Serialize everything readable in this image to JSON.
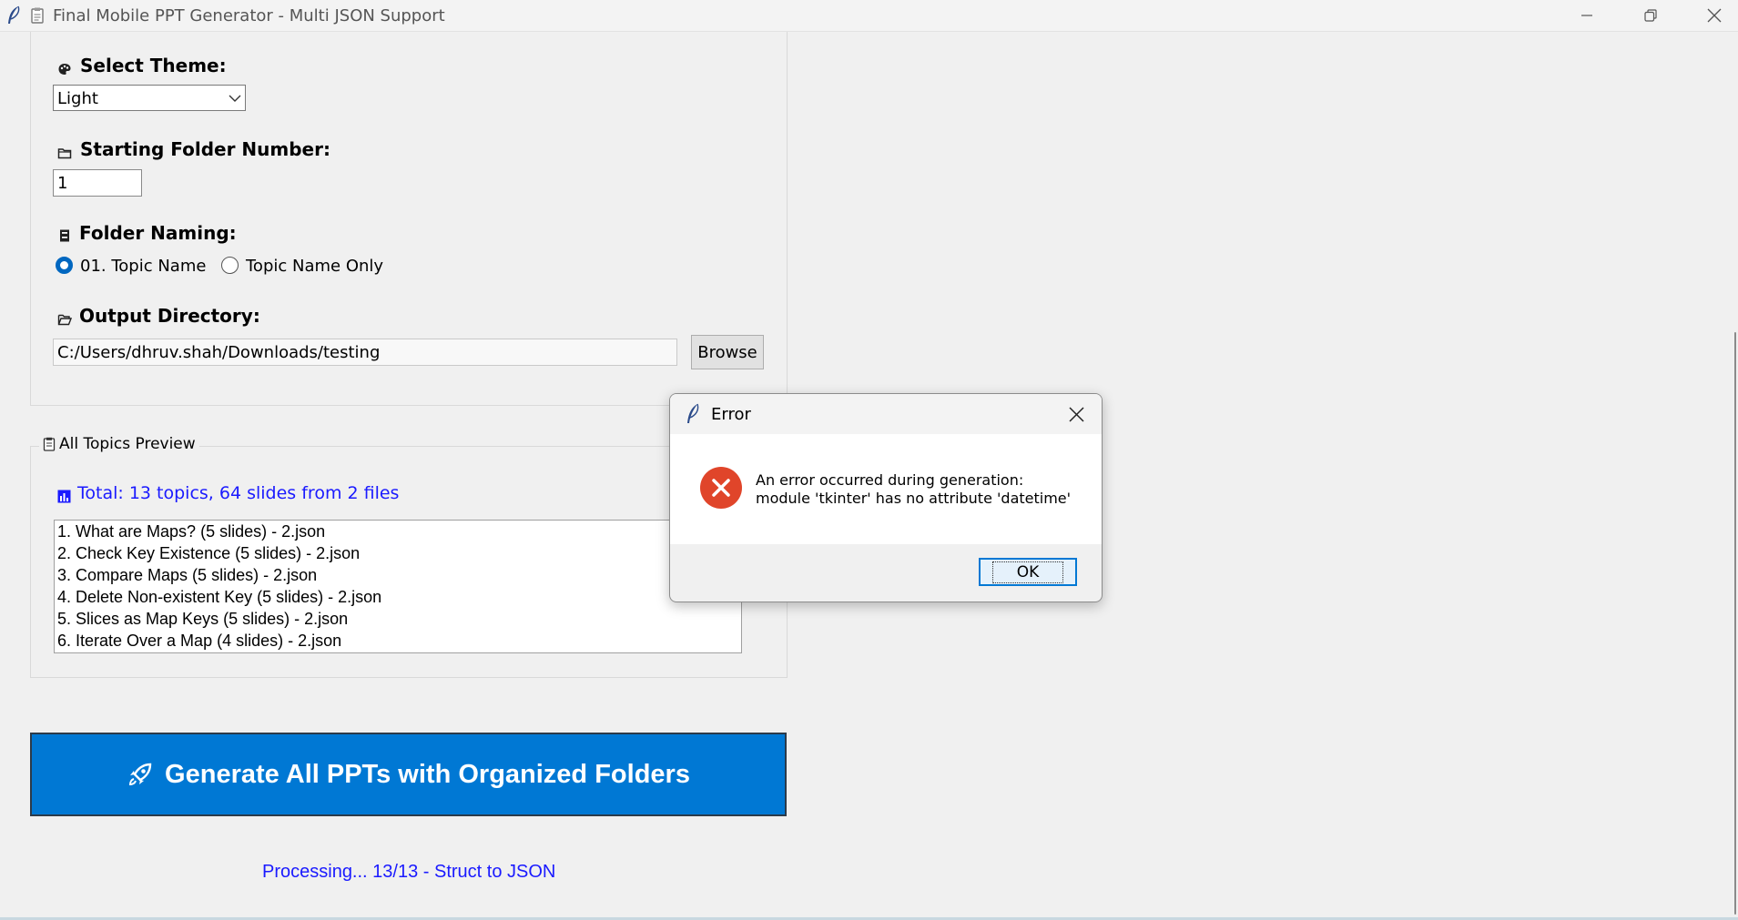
{
  "window": {
    "title": "Final Mobile PPT Generator - Multi JSON Support"
  },
  "settings": {
    "theme_label": "Select Theme:",
    "theme_value": "Light",
    "start_folder_label": "Starting Folder Number:",
    "start_folder_value": "1",
    "naming_label": "Folder Naming:",
    "naming_options": [
      "01. Topic Name",
      "Topic Name Only"
    ],
    "naming_selected": "01. Topic Name",
    "output_label": "Output Directory:",
    "output_value": "C:/Users/dhruv.shah/Downloads/testing",
    "browse_label": "Browse"
  },
  "preview": {
    "frame_label": "All Topics Preview",
    "total_text": "Total: 13 topics, 64 slides from 2 files",
    "items": [
      "1. What are Maps? (5 slides) - 2.json",
      "2. Check Key Existence (5 slides) - 2.json",
      "3. Compare Maps (5 slides) - 2.json",
      "4. Delete Non-existent Key (5 slides) - 2.json",
      "5. Slices as Map Keys (5 slides) - 2.json",
      "6. Iterate Over a Map (4 slides) - 2.json"
    ]
  },
  "generate_label": "Generate All PPTs with Organized Folders",
  "status_text": "Processing... 13/13 - Struct to JSON",
  "dialog": {
    "title": "Error",
    "line1": "An error occurred during generation:",
    "line2": "module 'tkinter' has no attribute 'datetime'",
    "ok_label": "OK"
  },
  "colors": {
    "accent": "#0078d4",
    "link_blue": "#1a1aff",
    "error_red": "#e0452a"
  }
}
